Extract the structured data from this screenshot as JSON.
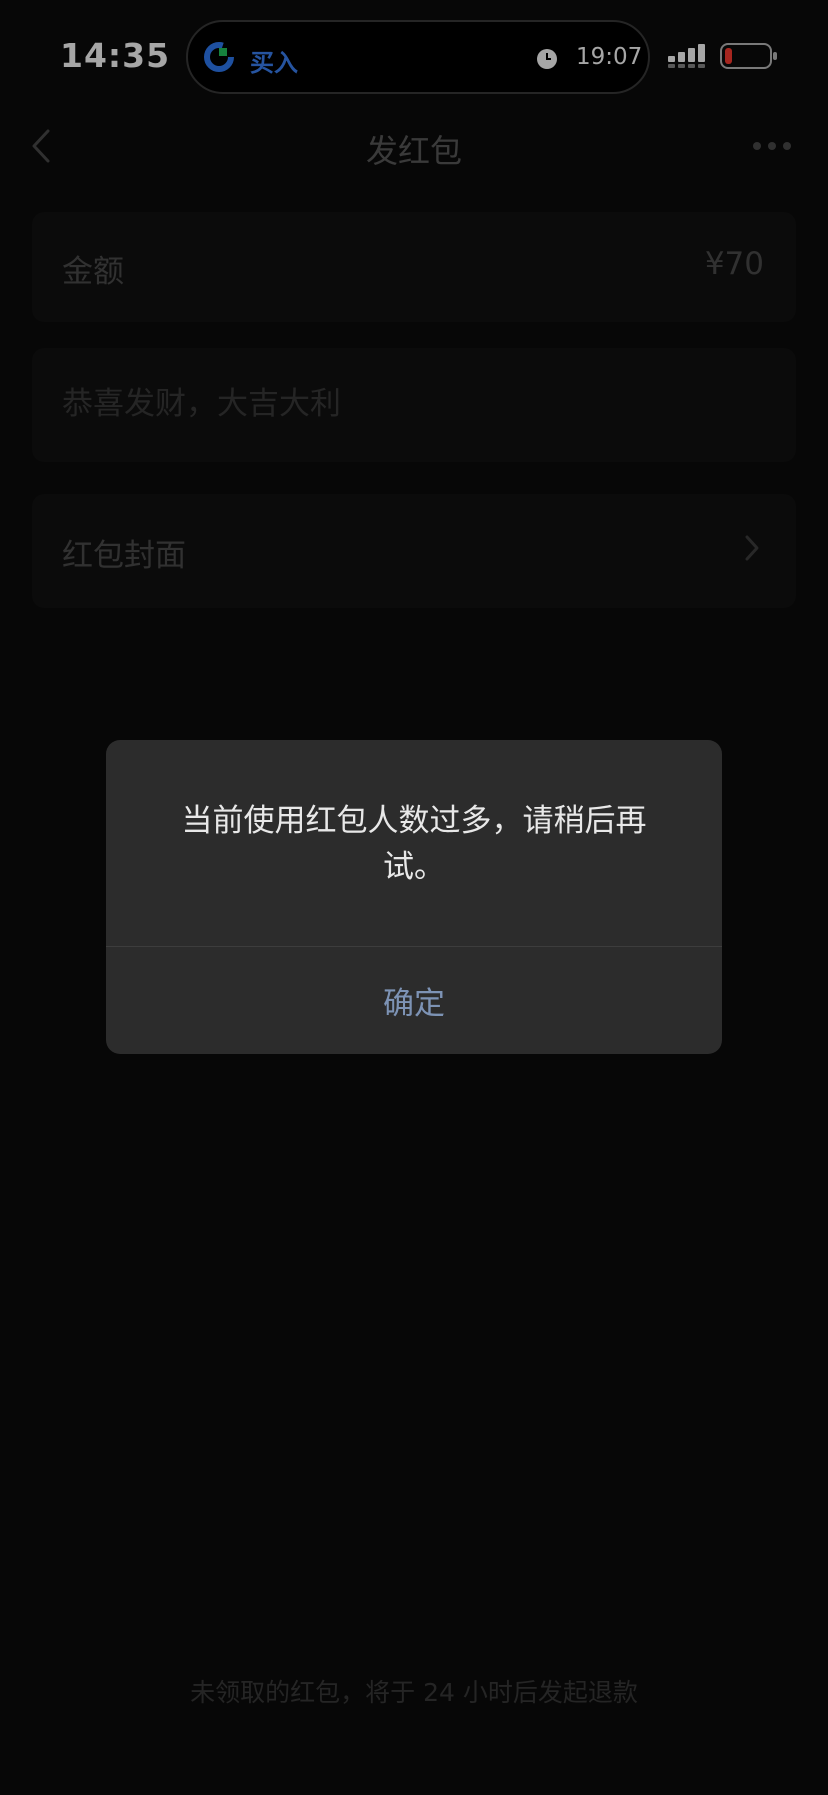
{
  "status_bar": {
    "time": "14:35",
    "island": {
      "app_label": "买入",
      "timer": "19:07"
    }
  },
  "nav": {
    "title": "发红包"
  },
  "form": {
    "amount_label": "金额",
    "amount_value": "¥70",
    "message_placeholder": "恭喜发财，大吉大利",
    "cover_label": "红包封面"
  },
  "footer": {
    "note": "未领取的红包，将于 24 小时后发起退款"
  },
  "dialog": {
    "message": "当前使用红包人数过多，请稍后再试。",
    "confirm_label": "确定"
  },
  "colors": {
    "accent_blue": "#3b82f6",
    "dialog_button": "#7d93b5",
    "battery_low": "#ff3b30"
  }
}
